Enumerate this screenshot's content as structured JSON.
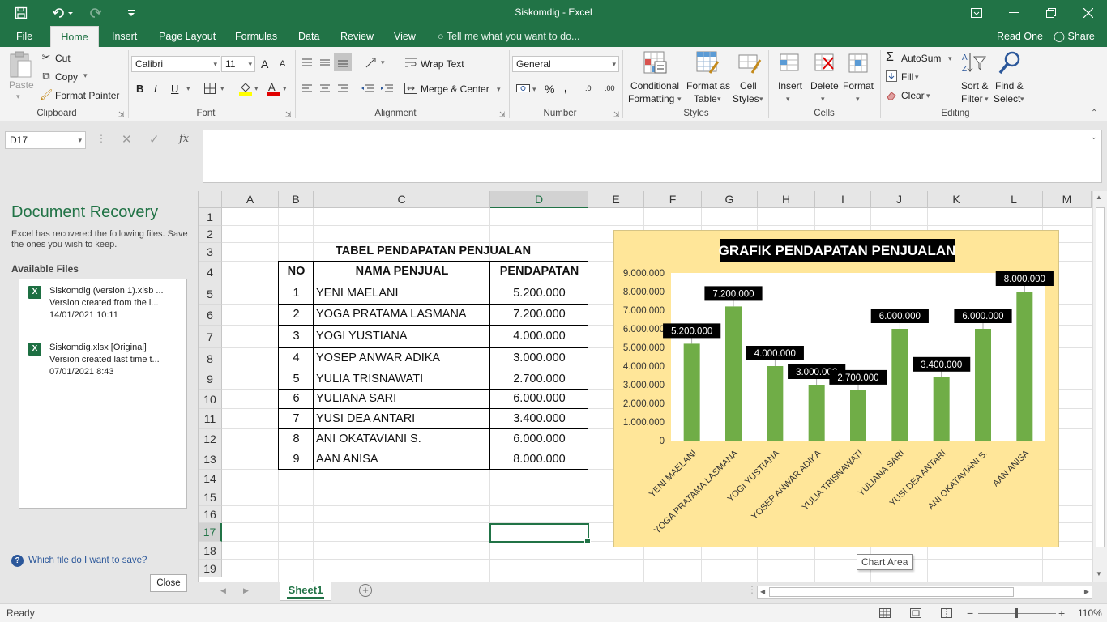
{
  "window": {
    "title": "Siskomdig - Excel"
  },
  "ribbon_tabs": [
    "File",
    "Home",
    "Insert",
    "Page Layout",
    "Formulas",
    "Data",
    "Review",
    "View"
  ],
  "active_tab": "Home",
  "tell_me": "Tell me what you want to do...",
  "account": {
    "read_one": "Read One",
    "share": "Share"
  },
  "clipboard": {
    "paste": "Paste",
    "cut": "Cut",
    "copy": "Copy",
    "format_painter": "Format Painter",
    "label": "Clipboard"
  },
  "font": {
    "name": "Calibri",
    "size": "11",
    "bold": "B",
    "italic": "I",
    "underline": "U",
    "grow": "A",
    "shrink": "A",
    "label": "Font"
  },
  "alignment": {
    "wrap_text": "Wrap Text",
    "merge_center": "Merge & Center",
    "label": "Alignment"
  },
  "number": {
    "format": "General",
    "percent": "%",
    "comma": ",",
    "inc_dec": ".0",
    "dec_dec": ".00",
    "label": "Number"
  },
  "styles": {
    "conditional": "Conditional",
    "conditional2": "Formatting",
    "format_as": "Format as",
    "table": "Table",
    "cell": "Cell",
    "cell_styles": "Styles",
    "label": "Styles"
  },
  "cells": {
    "insert": "Insert",
    "delete": "Delete",
    "format": "Format",
    "label": "Cells"
  },
  "editing": {
    "autosum": "AutoSum",
    "fill": "Fill",
    "clear": "Clear",
    "sort": "Sort &",
    "filter": "Filter",
    "find": "Find &",
    "select": "Select",
    "label": "Editing"
  },
  "formula_bar": {
    "name_box": "D17",
    "fx": "fx",
    "content": ""
  },
  "recovery": {
    "title": "Document Recovery",
    "description": "Excel has recovered the following files. Save the ones you wish to keep.",
    "available": "Available Files",
    "files": [
      {
        "name": "Siskomdig (version 1).xlsb  ...",
        "note": "Version created from the l...",
        "date": "14/01/2021 10:11"
      },
      {
        "name": "Siskomdig.xlsx  [Original]",
        "note": "Version created last time t...",
        "date": "07/01/2021 8:43"
      }
    ],
    "help": "Which file do I want to save?",
    "close": "Close"
  },
  "columns": [
    "A",
    "B",
    "C",
    "D",
    "E",
    "F",
    "G",
    "H",
    "I",
    "J",
    "K",
    "L",
    "M"
  ],
  "rows": [
    "1",
    "2",
    "3",
    "4",
    "5",
    "6",
    "7",
    "8",
    "9",
    "10",
    "11",
    "12",
    "13",
    "14",
    "15",
    "16",
    "17",
    "18",
    "19"
  ],
  "table": {
    "title": "TABEL PENDAPATAN PENJUALAN",
    "headers": [
      "NO",
      "NAMA PENJUAL",
      "PENDAPATAN"
    ],
    "rows": [
      {
        "no": "1",
        "name": "YENI MAELANI",
        "value": "5.200.000"
      },
      {
        "no": "2",
        "name": "YOGA PRATAMA LASMANA",
        "value": "7.200.000"
      },
      {
        "no": "3",
        "name": "YOGI YUSTIANA",
        "value": "4.000.000"
      },
      {
        "no": "4",
        "name": "YOSEP ANWAR ADIKA",
        "value": "3.000.000"
      },
      {
        "no": "5",
        "name": "YULIA TRISNAWATI",
        "value": "2.700.000"
      },
      {
        "no": "6",
        "name": "YULIANA SARI",
        "value": "6.000.000"
      },
      {
        "no": "7",
        "name": "YUSI DEA ANTARI",
        "value": "3.400.000"
      },
      {
        "no": "8",
        "name": "ANI OKATAVIANI S.",
        "value": "6.000.000"
      },
      {
        "no": "9",
        "name": "AAN ANISA",
        "value": "8.000.000"
      }
    ]
  },
  "chart_data": {
    "type": "bar",
    "title": "GRAFIK PENDAPATAN PENJUALAN",
    "categories": [
      "YENI MAELANI",
      "YOGA PRATAMA LASMANA",
      "YOGI YUSTIANA",
      "YOSEP ANWAR ADIKA",
      "YULIA TRISNAWATI",
      "YULIANA SARI",
      "YUSI DEA ANTARI",
      "ANI OKATAVIANI S.",
      "AAN ANISA"
    ],
    "values": [
      5200000,
      7200000,
      4000000,
      3000000,
      2700000,
      6000000,
      3400000,
      6000000,
      8000000
    ],
    "data_labels": [
      "5.200.000",
      "7.200.000",
      "4.000.000",
      "3.000.000",
      "2.700.000",
      "6.000.000",
      "3.400.000",
      "6.000.000",
      "8.000.000"
    ],
    "y_ticks": [
      "0",
      "1.000.000",
      "2.000.000",
      "3.000.000",
      "4.000.000",
      "5.000.000",
      "6.000.000",
      "7.000.000",
      "8.000.000",
      "9.000.000"
    ],
    "ylim": [
      0,
      9000000
    ],
    "bar_color": "#70ad47",
    "background": "#ffe699",
    "grid": false,
    "legend": "none"
  },
  "chart_tooltip": "Chart Area",
  "sheet": {
    "tab": "Sheet1",
    "add": "+"
  },
  "status": {
    "ready": "Ready",
    "zoom": "110%"
  },
  "colors": {
    "accent": "#217346"
  }
}
